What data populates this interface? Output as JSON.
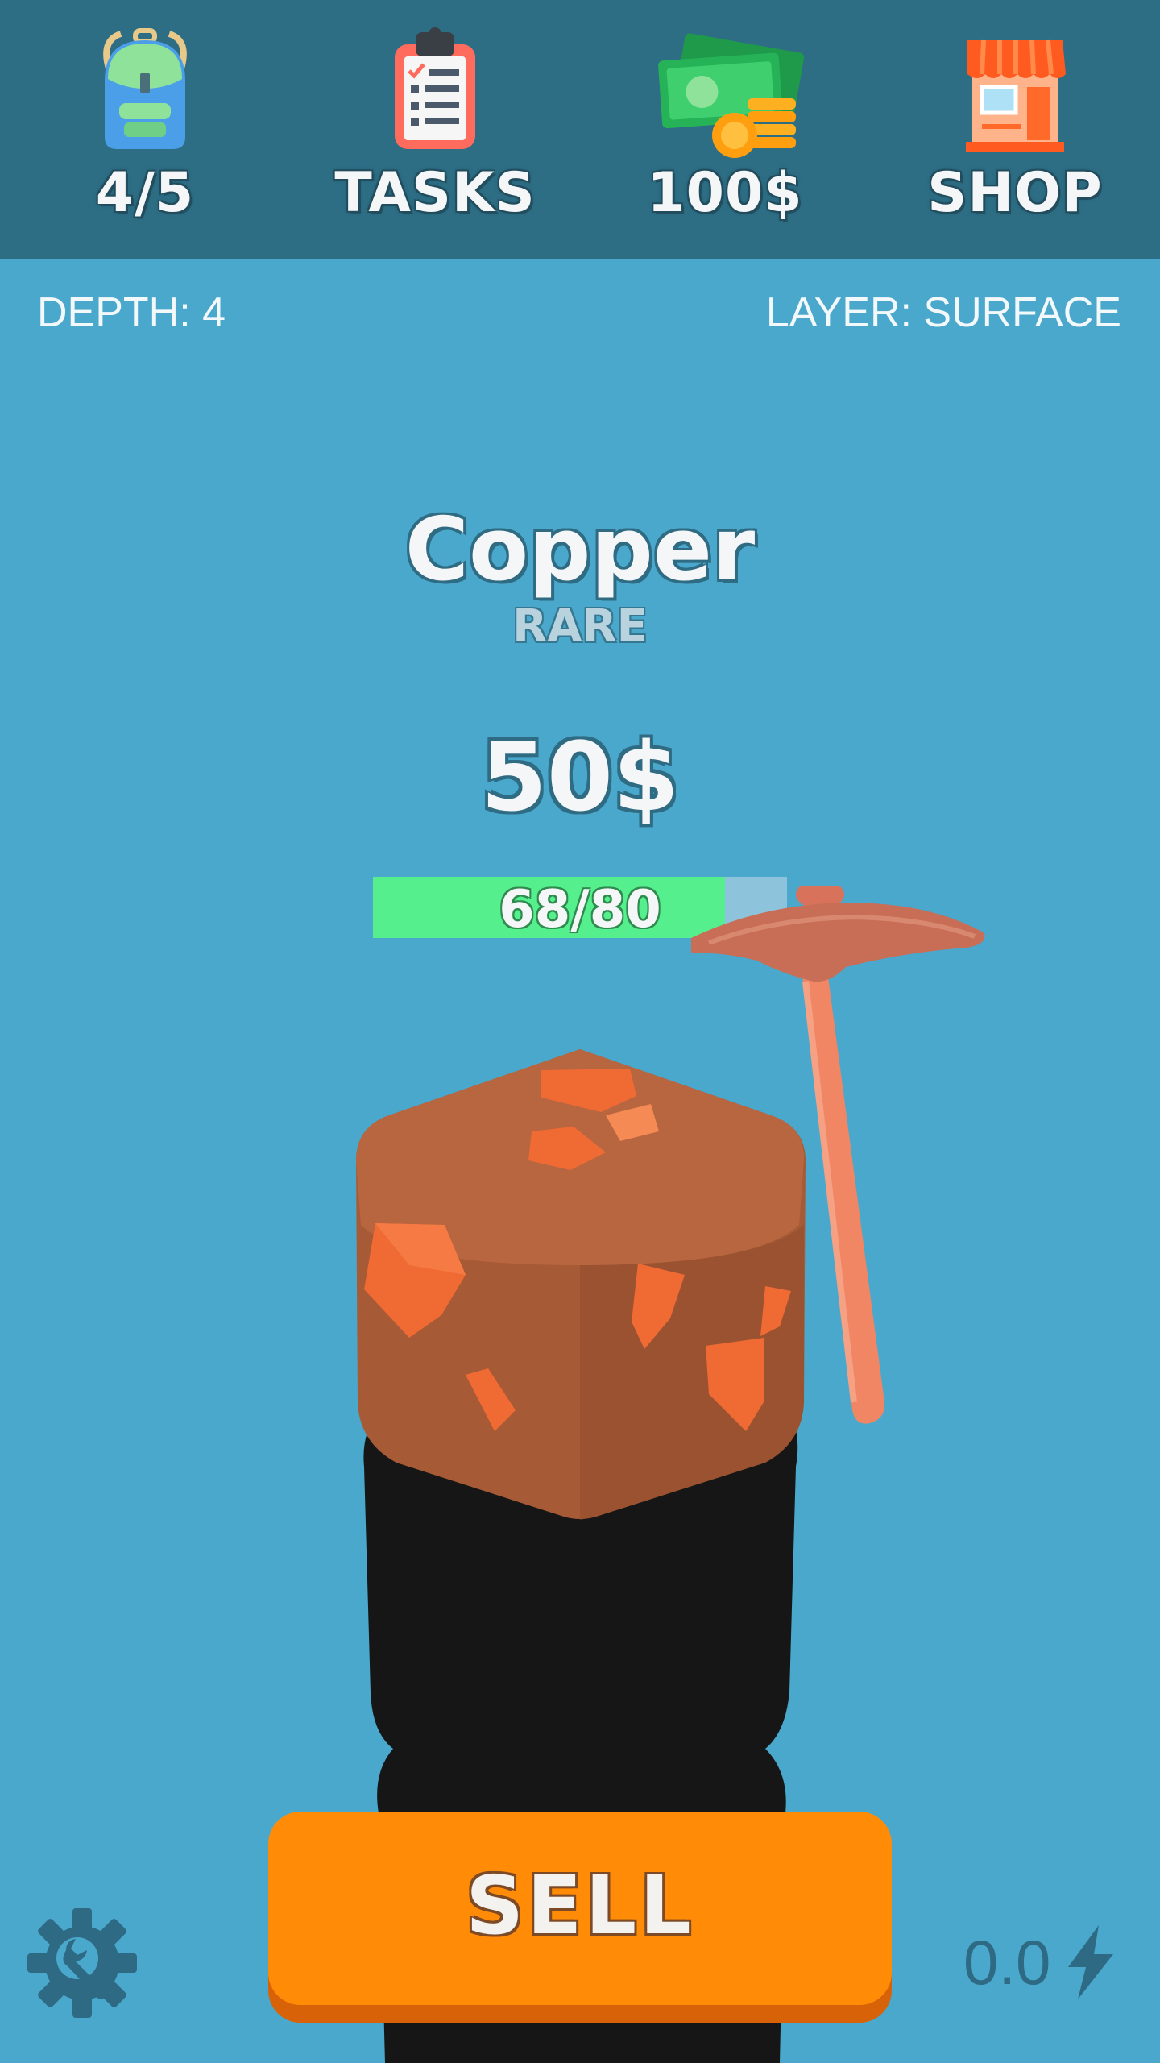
{
  "topbar": {
    "backpack": {
      "icon": "backpack-icon",
      "label": "4/5"
    },
    "tasks": {
      "icon": "clipboard-icon",
      "label": "TASKS"
    },
    "money": {
      "icon": "cash-icon",
      "label": "100$"
    },
    "shop": {
      "icon": "shop-icon",
      "label": "SHOP"
    }
  },
  "status": {
    "depth": "DEPTH: 4",
    "layer": "LAYER: SURFACE"
  },
  "ore": {
    "name": "Copper",
    "rarity": "RARE",
    "price": "50$",
    "durability_text": "68/80",
    "durability_fraction": 0.85
  },
  "actions": {
    "sell_label": "SELL",
    "settings_icon": "settings-wrench-icon",
    "speed_value": "0.0",
    "speed_icon": "lightning-icon"
  },
  "colors": {
    "background": "#4aa8cc",
    "topbar": "#2d6e85",
    "progress_fill": "#56ef8d",
    "sell_button": "#ff8b07",
    "ore_block": "#b8663f",
    "ore_vein": "#f06a34",
    "pickaxe": "#f08664"
  }
}
